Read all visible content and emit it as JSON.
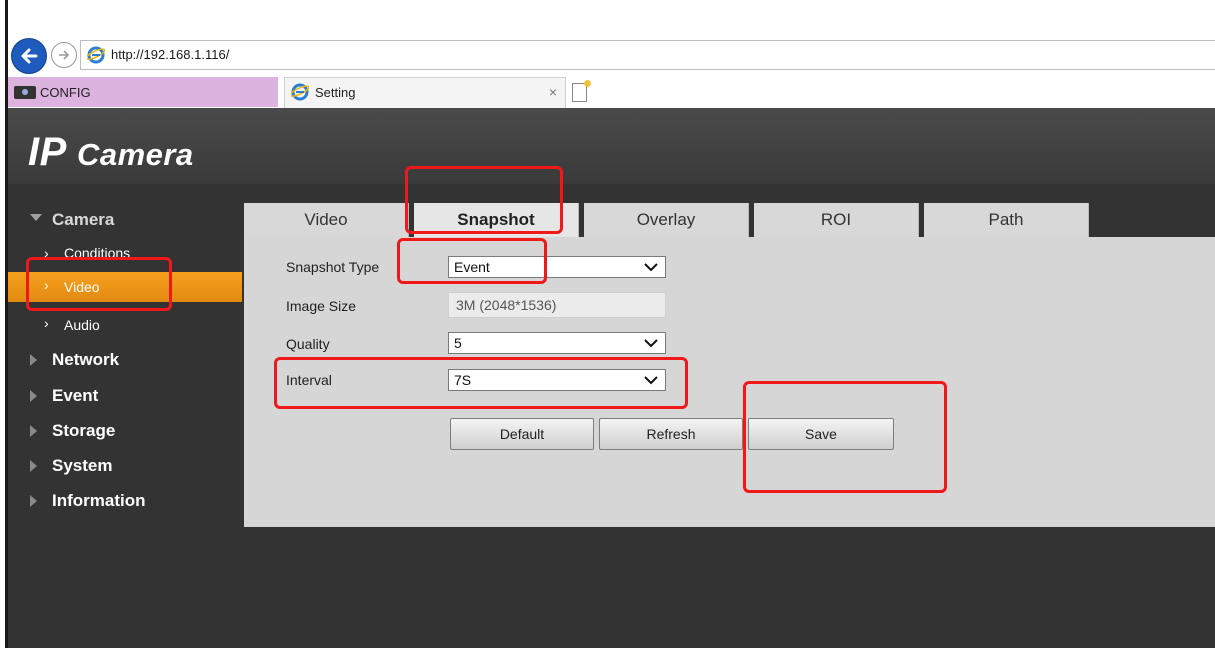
{
  "browser": {
    "url": "http://192.168.1.116/",
    "tabs": [
      {
        "label": "CONFIG"
      },
      {
        "label": "Setting",
        "close": "×"
      }
    ]
  },
  "app": {
    "logo_main": "IP",
    "logo_sub": "Camera"
  },
  "sidebar": {
    "camera": "Camera",
    "camera_children": [
      "Conditions",
      "Video",
      "Audio"
    ],
    "sections": [
      "Network",
      "Event",
      "Storage",
      "System",
      "Information"
    ]
  },
  "tabs": [
    "Video",
    "Snapshot",
    "Overlay",
    "ROI",
    "Path"
  ],
  "active_tab": "Snapshot",
  "form": {
    "snapshot_type": {
      "label": "Snapshot Type",
      "value": "Event"
    },
    "image_size": {
      "label": "Image Size",
      "value": "3M (2048*1536)"
    },
    "quality": {
      "label": "Quality",
      "value": "5"
    },
    "interval": {
      "label": "Interval",
      "value": "7S"
    }
  },
  "buttons": {
    "default": "Default",
    "refresh": "Refresh",
    "save": "Save"
  },
  "colors": {
    "accent": "#f7a01e",
    "annotation": "#f01818",
    "header_bg": "#3f3f3f",
    "panel_bg": "#d6d6d6"
  },
  "icons": [
    "back-arrow-icon",
    "forward-arrow-icon",
    "ie-icon",
    "camera-icon",
    "new-tab-icon"
  ]
}
